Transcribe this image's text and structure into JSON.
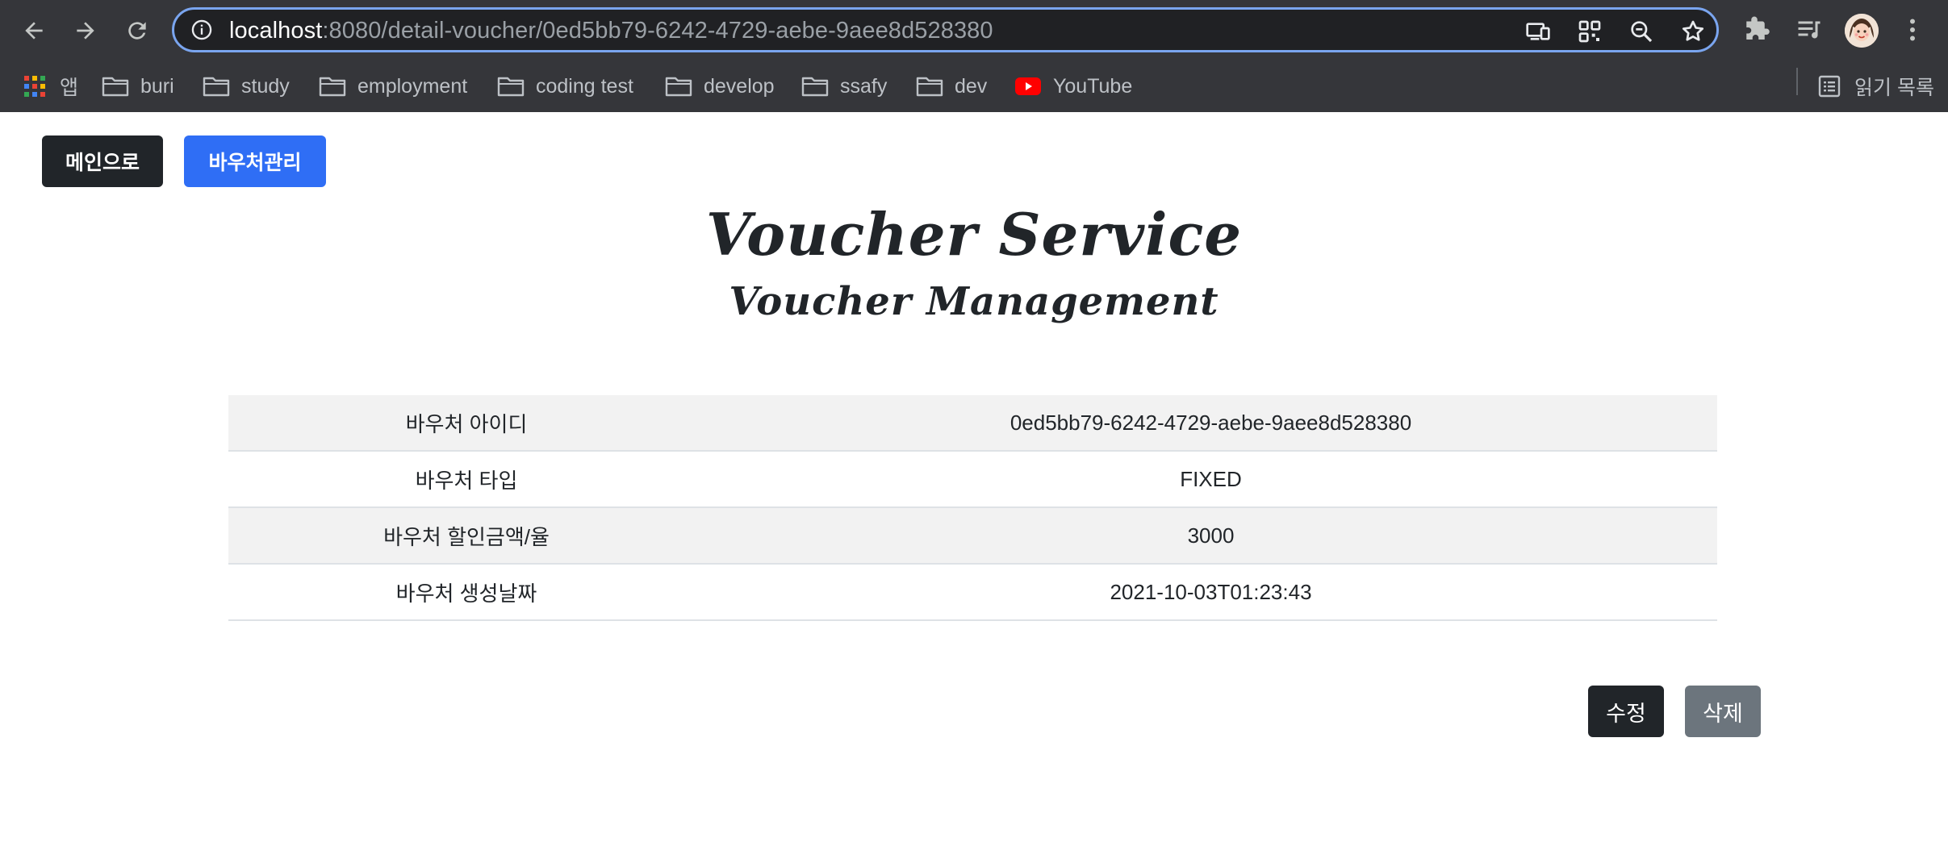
{
  "browser": {
    "url_host": "localhost",
    "url_rest": ":8080/detail-voucher/0ed5bb79-6242-4729-aebe-9aee8d528380",
    "bookmarks": [
      {
        "label": "앱",
        "icon": "apps-grid-icon"
      },
      {
        "label": "buri",
        "icon": "folder-icon"
      },
      {
        "label": "study",
        "icon": "folder-icon"
      },
      {
        "label": "employment",
        "icon": "folder-icon"
      },
      {
        "label": "coding test",
        "icon": "folder-icon"
      },
      {
        "label": "develop",
        "icon": "folder-icon"
      },
      {
        "label": "ssafy",
        "icon": "folder-icon"
      },
      {
        "label": "dev",
        "icon": "folder-icon"
      },
      {
        "label": "YouTube",
        "icon": "youtube-icon"
      }
    ],
    "reading_list": "읽기 목록"
  },
  "page": {
    "nav": {
      "main_label": "메인으로",
      "voucher_label": "바우처관리"
    },
    "title": "Voucher Service",
    "subtitle": "Voucher Management",
    "rows": [
      {
        "key": "바우처 아이디",
        "value": "0ed5bb79-6242-4729-aebe-9aee8d528380"
      },
      {
        "key": "바우처 타입",
        "value": "FIXED"
      },
      {
        "key": "바우처 할인금액/율",
        "value": "3000"
      },
      {
        "key": "바우처 생성날짜",
        "value": "2021-10-03T01:23:43"
      }
    ],
    "actions": {
      "edit_label": "수정",
      "delete_label": "삭제"
    }
  },
  "colors": {
    "chrome_bg": "#35363a",
    "omnibox_border": "#7aa5ef",
    "dark_button": "#212529",
    "primary_button": "#2f6ef5",
    "secondary_button": "#6c757d"
  }
}
